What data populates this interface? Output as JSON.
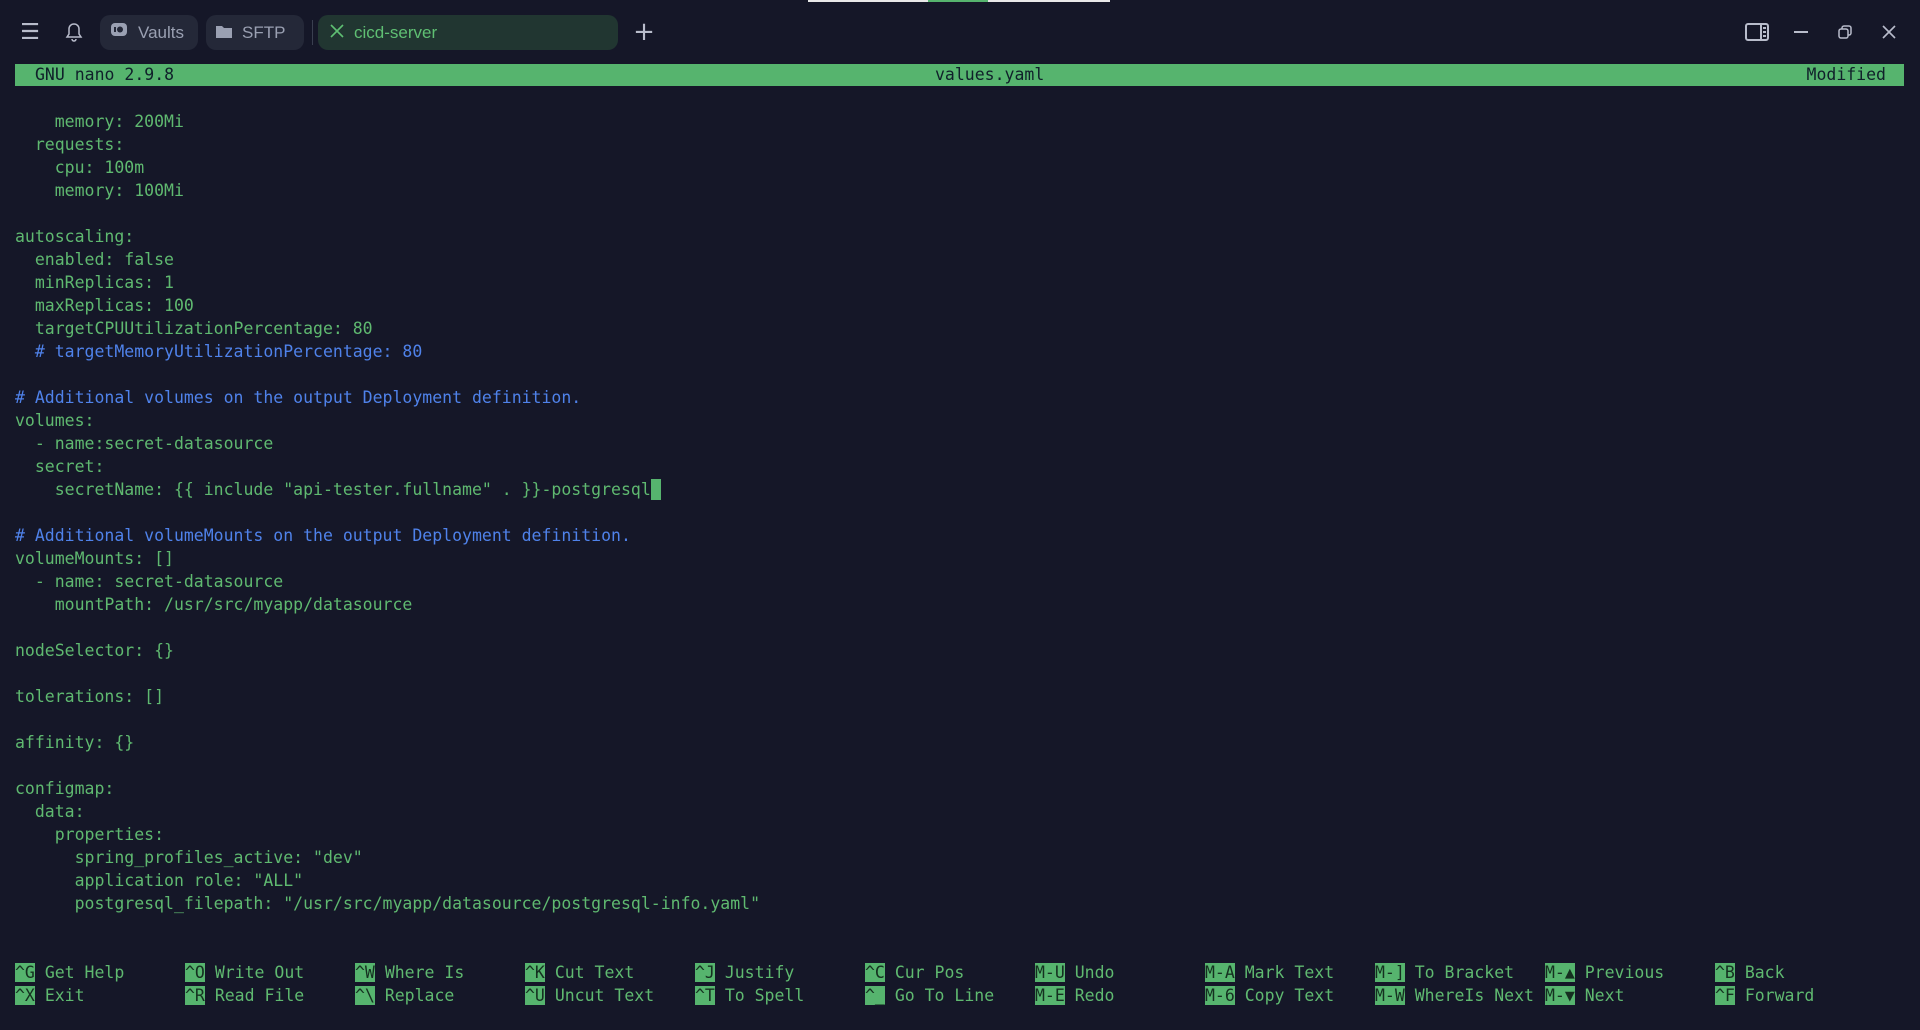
{
  "topbar": {
    "menu_icon": "hamburger-menu-icon",
    "bell_icon": "bell-icon",
    "tabs": [
      {
        "label": "Vaults",
        "icon": "vault-icon"
      },
      {
        "label": "SFTP",
        "icon": "folder-icon"
      },
      {
        "label": "cicd-server",
        "icon": "close-icon",
        "active": true
      }
    ],
    "new_tab_icon": "plus-icon",
    "window_controls": [
      "sidebar-toggle-icon",
      "minimize-icon",
      "restore-icon",
      "close-icon"
    ]
  },
  "nano": {
    "version": "GNU nano 2.9.8",
    "filename": "values.yaml",
    "status": "Modified",
    "lines": [
      {
        "text": "    memory: 200Mi"
      },
      {
        "text": "  requests:"
      },
      {
        "text": "    cpu: 100m"
      },
      {
        "text": "    memory: 100Mi"
      },
      {
        "text": ""
      },
      {
        "text": "autoscaling:"
      },
      {
        "text": "  enabled: false"
      },
      {
        "text": "  minReplicas: 1"
      },
      {
        "text": "  maxReplicas: 100"
      },
      {
        "text": "  targetCPUUtilizationPercentage: 80"
      },
      {
        "text": "  # targetMemoryUtilizationPercentage: 80",
        "comment": true
      },
      {
        "text": ""
      },
      {
        "text": "# Additional volumes on the output Deployment definition.",
        "comment": true
      },
      {
        "text": "volumes:"
      },
      {
        "text": "  - name:secret-datasource"
      },
      {
        "text": "  secret:"
      },
      {
        "text": "    secretName: {{ include \"api-tester.fullname\" . }}-postgresql",
        "cursor": true
      },
      {
        "text": ""
      },
      {
        "text": "# Additional volumeMounts on the output Deployment definition.",
        "comment": true
      },
      {
        "text": "volumeMounts: []"
      },
      {
        "text": "  - name: secret-datasource"
      },
      {
        "text": "    mountPath: /usr/src/myapp/datasource"
      },
      {
        "text": ""
      },
      {
        "text": "nodeSelector: {}"
      },
      {
        "text": ""
      },
      {
        "text": "tolerations: []"
      },
      {
        "text": ""
      },
      {
        "text": "affinity: {}"
      },
      {
        "text": ""
      },
      {
        "text": "configmap:"
      },
      {
        "text": "  data:"
      },
      {
        "text": "    properties:"
      },
      {
        "text": "      spring_profiles_active: \"dev\""
      },
      {
        "text": "      application role: \"ALL\""
      },
      {
        "text": "      postgresql_filepath: \"/usr/src/myapp/datasource/postgresql-info.yaml\""
      }
    ],
    "shortcuts": [
      [
        {
          "key": "^G",
          "label": "Get Help"
        },
        {
          "key": "^X",
          "label": "Exit"
        }
      ],
      [
        {
          "key": "^O",
          "label": "Write Out"
        },
        {
          "key": "^R",
          "label": "Read File"
        }
      ],
      [
        {
          "key": "^W",
          "label": "Where Is"
        },
        {
          "key": "^\\",
          "label": "Replace"
        }
      ],
      [
        {
          "key": "^K",
          "label": "Cut Text"
        },
        {
          "key": "^U",
          "label": "Uncut Text"
        }
      ],
      [
        {
          "key": "^J",
          "label": "Justify"
        },
        {
          "key": "^T",
          "label": "To Spell"
        }
      ],
      [
        {
          "key": "^C",
          "label": "Cur Pos"
        },
        {
          "key": "^_",
          "label": "Go To Line"
        }
      ],
      [
        {
          "key": "M-U",
          "label": "Undo"
        },
        {
          "key": "M-E",
          "label": "Redo"
        }
      ],
      [
        {
          "key": "M-A",
          "label": "Mark Text"
        },
        {
          "key": "M-6",
          "label": "Copy Text"
        }
      ],
      [
        {
          "key": "M-]",
          "label": "To Bracket"
        },
        {
          "key": "M-W",
          "label": "WhereIs Next"
        }
      ],
      [
        {
          "key": "M-▲",
          "label": "Previous"
        },
        {
          "key": "M-▼",
          "label": "Next"
        }
      ],
      [
        {
          "key": "^B",
          "label": "Back"
        },
        {
          "key": "^F",
          "label": "Forward"
        }
      ]
    ]
  },
  "colors": {
    "accent": "#56b46e",
    "comment": "#4f82ea",
    "background": "#151728"
  }
}
